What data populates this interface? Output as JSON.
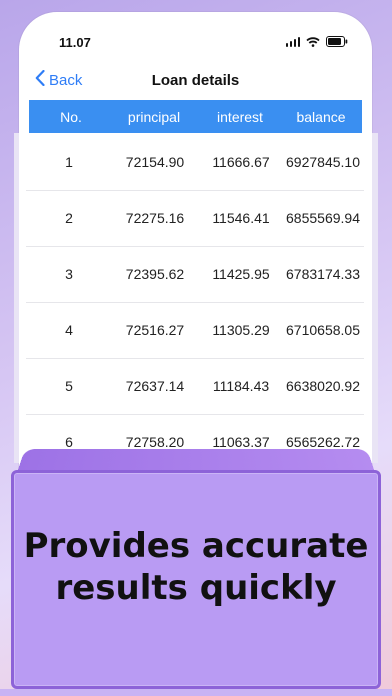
{
  "status": {
    "time": "11.07"
  },
  "nav": {
    "back_label": "Back",
    "title": "Loan details"
  },
  "table": {
    "headers": {
      "no": "No.",
      "principal": "principal",
      "interest": "interest",
      "balance": "balance"
    },
    "rows": [
      {
        "no": "1",
        "principal": "72154.90",
        "interest": "11666.67",
        "balance": "6927845.10"
      },
      {
        "no": "2",
        "principal": "72275.16",
        "interest": "11546.41",
        "balance": "6855569.94"
      },
      {
        "no": "3",
        "principal": "72395.62",
        "interest": "11425.95",
        "balance": "6783174.33"
      },
      {
        "no": "4",
        "principal": "72516.27",
        "interest": "11305.29",
        "balance": "6710658.05"
      },
      {
        "no": "5",
        "principal": "72637.14",
        "interest": "11184.43",
        "balance": "6638020.92"
      },
      {
        "no": "6",
        "principal": "72758.20",
        "interest": "11063.37",
        "balance": "6565262.72"
      }
    ]
  },
  "promo": {
    "line1": "Provides accurate",
    "line2": "results quickly"
  },
  "colors": {
    "accent": "#3a8ff1",
    "promo_bg": "#b99bf3",
    "promo_border": "#8d63d8"
  }
}
